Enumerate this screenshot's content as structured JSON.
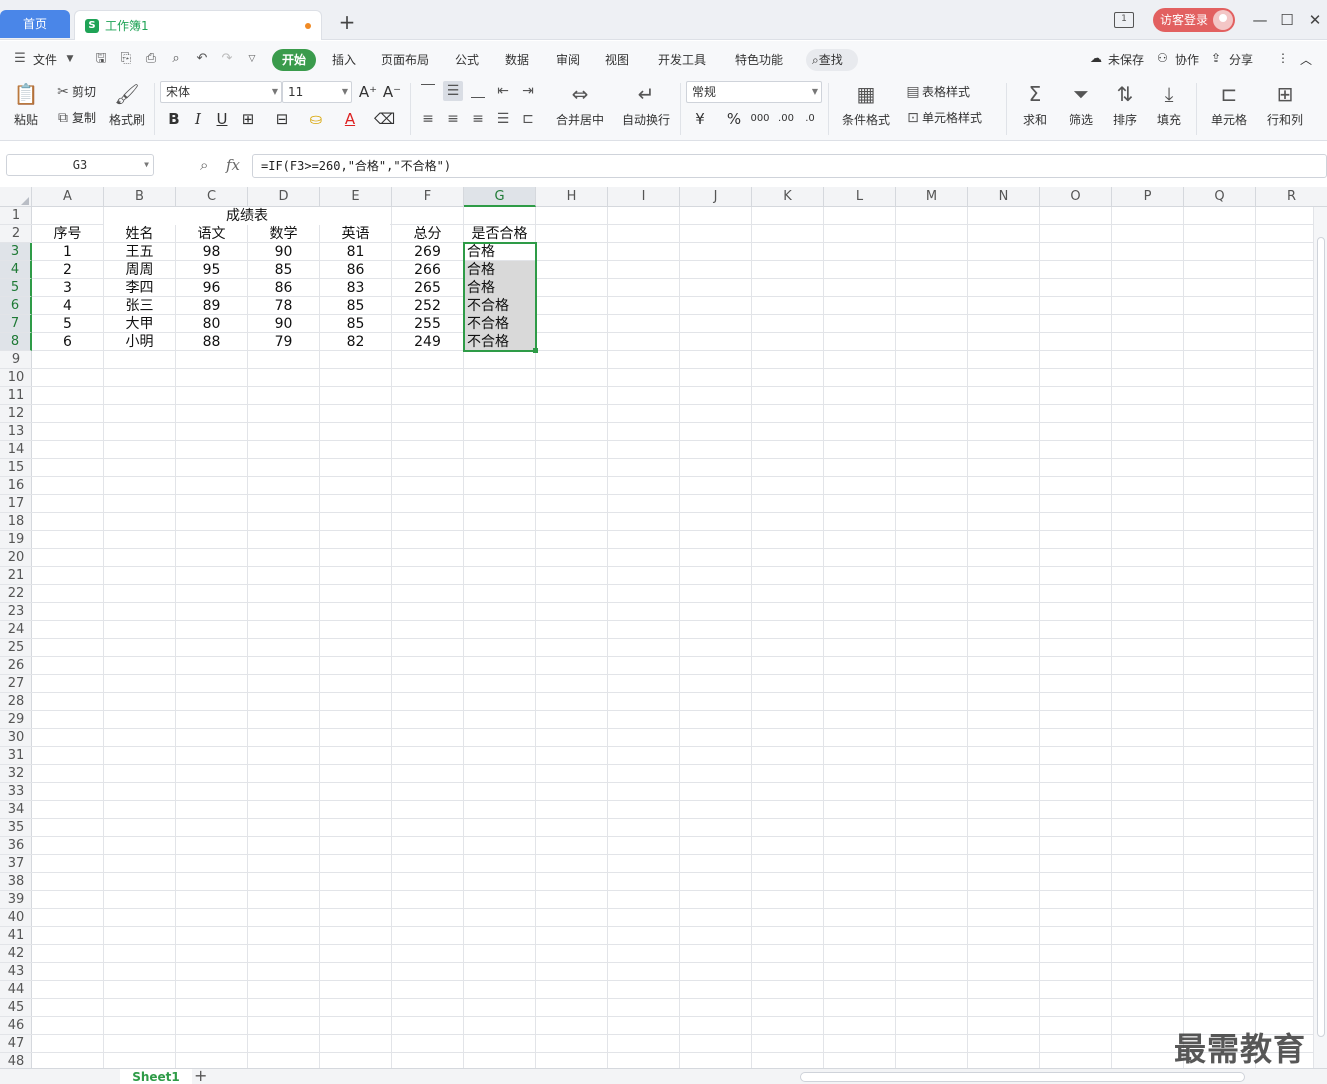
{
  "titlebar": {
    "home_tab": "首页",
    "doc_tab": "工作簿1",
    "add_tab": "+",
    "dual_icon_text": "1",
    "login_label": "访客登录",
    "minimize": "—",
    "maximize": "☐",
    "close": "✕"
  },
  "menubar": {
    "file": "文件",
    "items": [
      "开始",
      "插入",
      "页面布局",
      "公式",
      "数据",
      "审阅",
      "视图",
      "开发工具",
      "特色功能"
    ],
    "search": "查找",
    "unsaved": "未保存",
    "collab": "协作",
    "share": "分享"
  },
  "ribbon": {
    "paste": "粘贴",
    "cut": "剪切",
    "copy": "复制",
    "format_painter": "格式刷",
    "font_name": "宋体",
    "font_size": "11",
    "merge_center": "合并居中",
    "wrap_text": "自动换行",
    "number_format": "常规",
    "conditional_format": "条件格式",
    "table_style": "表格样式",
    "cell_style": "单元格样式",
    "sum": "求和",
    "filter": "筛选",
    "sort": "排序",
    "fill": "填充",
    "cell": "单元格",
    "rows_cols": "行和列"
  },
  "formula_bar": {
    "name_box": "G3",
    "fx": "fx",
    "formula": "=IF(F3>=260,\"合格\",\"不合格\")"
  },
  "sheet": {
    "columns": [
      "A",
      "B",
      "C",
      "D",
      "E",
      "F",
      "G",
      "H",
      "I",
      "J",
      "K",
      "L",
      "M",
      "N",
      "O",
      "P",
      "Q",
      "R"
    ],
    "selected_column": "G",
    "rows": [
      "1",
      "2",
      "3",
      "4",
      "5",
      "6",
      "7",
      "8",
      "9",
      "10",
      "11",
      "12",
      "13",
      "14",
      "15",
      "16",
      "17",
      "18",
      "19",
      "20",
      "21",
      "22",
      "23",
      "24",
      "25",
      "26",
      "27",
      "28",
      "29",
      "30",
      "31",
      "32",
      "33",
      "34",
      "35",
      "36",
      "37",
      "38",
      "39",
      "40",
      "41",
      "42",
      "43",
      "44",
      "45",
      "46",
      "47",
      "48"
    ],
    "title": "成绩表",
    "headers": [
      "序号",
      "姓名",
      "语文",
      "数学",
      "英语",
      "总分",
      "是否合格"
    ],
    "data": [
      [
        "1",
        "王五",
        "98",
        "90",
        "81",
        "269",
        "合格"
      ],
      [
        "2",
        "周周",
        "95",
        "85",
        "86",
        "266",
        "合格"
      ],
      [
        "3",
        "李四",
        "96",
        "86",
        "83",
        "265",
        "合格"
      ],
      [
        "4",
        "张三",
        "89",
        "78",
        "85",
        "252",
        "不合格"
      ],
      [
        "5",
        "大甲",
        "80",
        "90",
        "85",
        "255",
        "不合格"
      ],
      [
        "6",
        "小明",
        "88",
        "79",
        "82",
        "249",
        "不合格"
      ]
    ]
  },
  "sheet_tabs": {
    "active": "Sheet1",
    "add": "+"
  },
  "watermark": "最需教育"
}
